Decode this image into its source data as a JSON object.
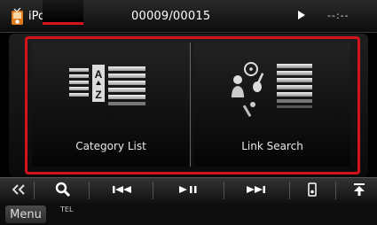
{
  "topbar": {
    "source_label": "iPod",
    "source_icon": "ipod-icon",
    "track_count": "00009/00015",
    "play_state_icon": "play-icon",
    "time": "--:--"
  },
  "tiles": {
    "left": {
      "label": "Category List",
      "icon": "category-list-icon"
    },
    "right": {
      "label": "Link Search",
      "icon": "link-search-icon"
    }
  },
  "controls": {
    "items": [
      "rewind-double-chevron-icon",
      "search-icon",
      "previous-track-icon",
      "play-pause-icon",
      "next-track-icon",
      "device-icon",
      "eject-icon"
    ],
    "highlight_color": "#d4131a"
  },
  "bottombar": {
    "menu_label": "Menu",
    "tel_label": "TEL"
  }
}
